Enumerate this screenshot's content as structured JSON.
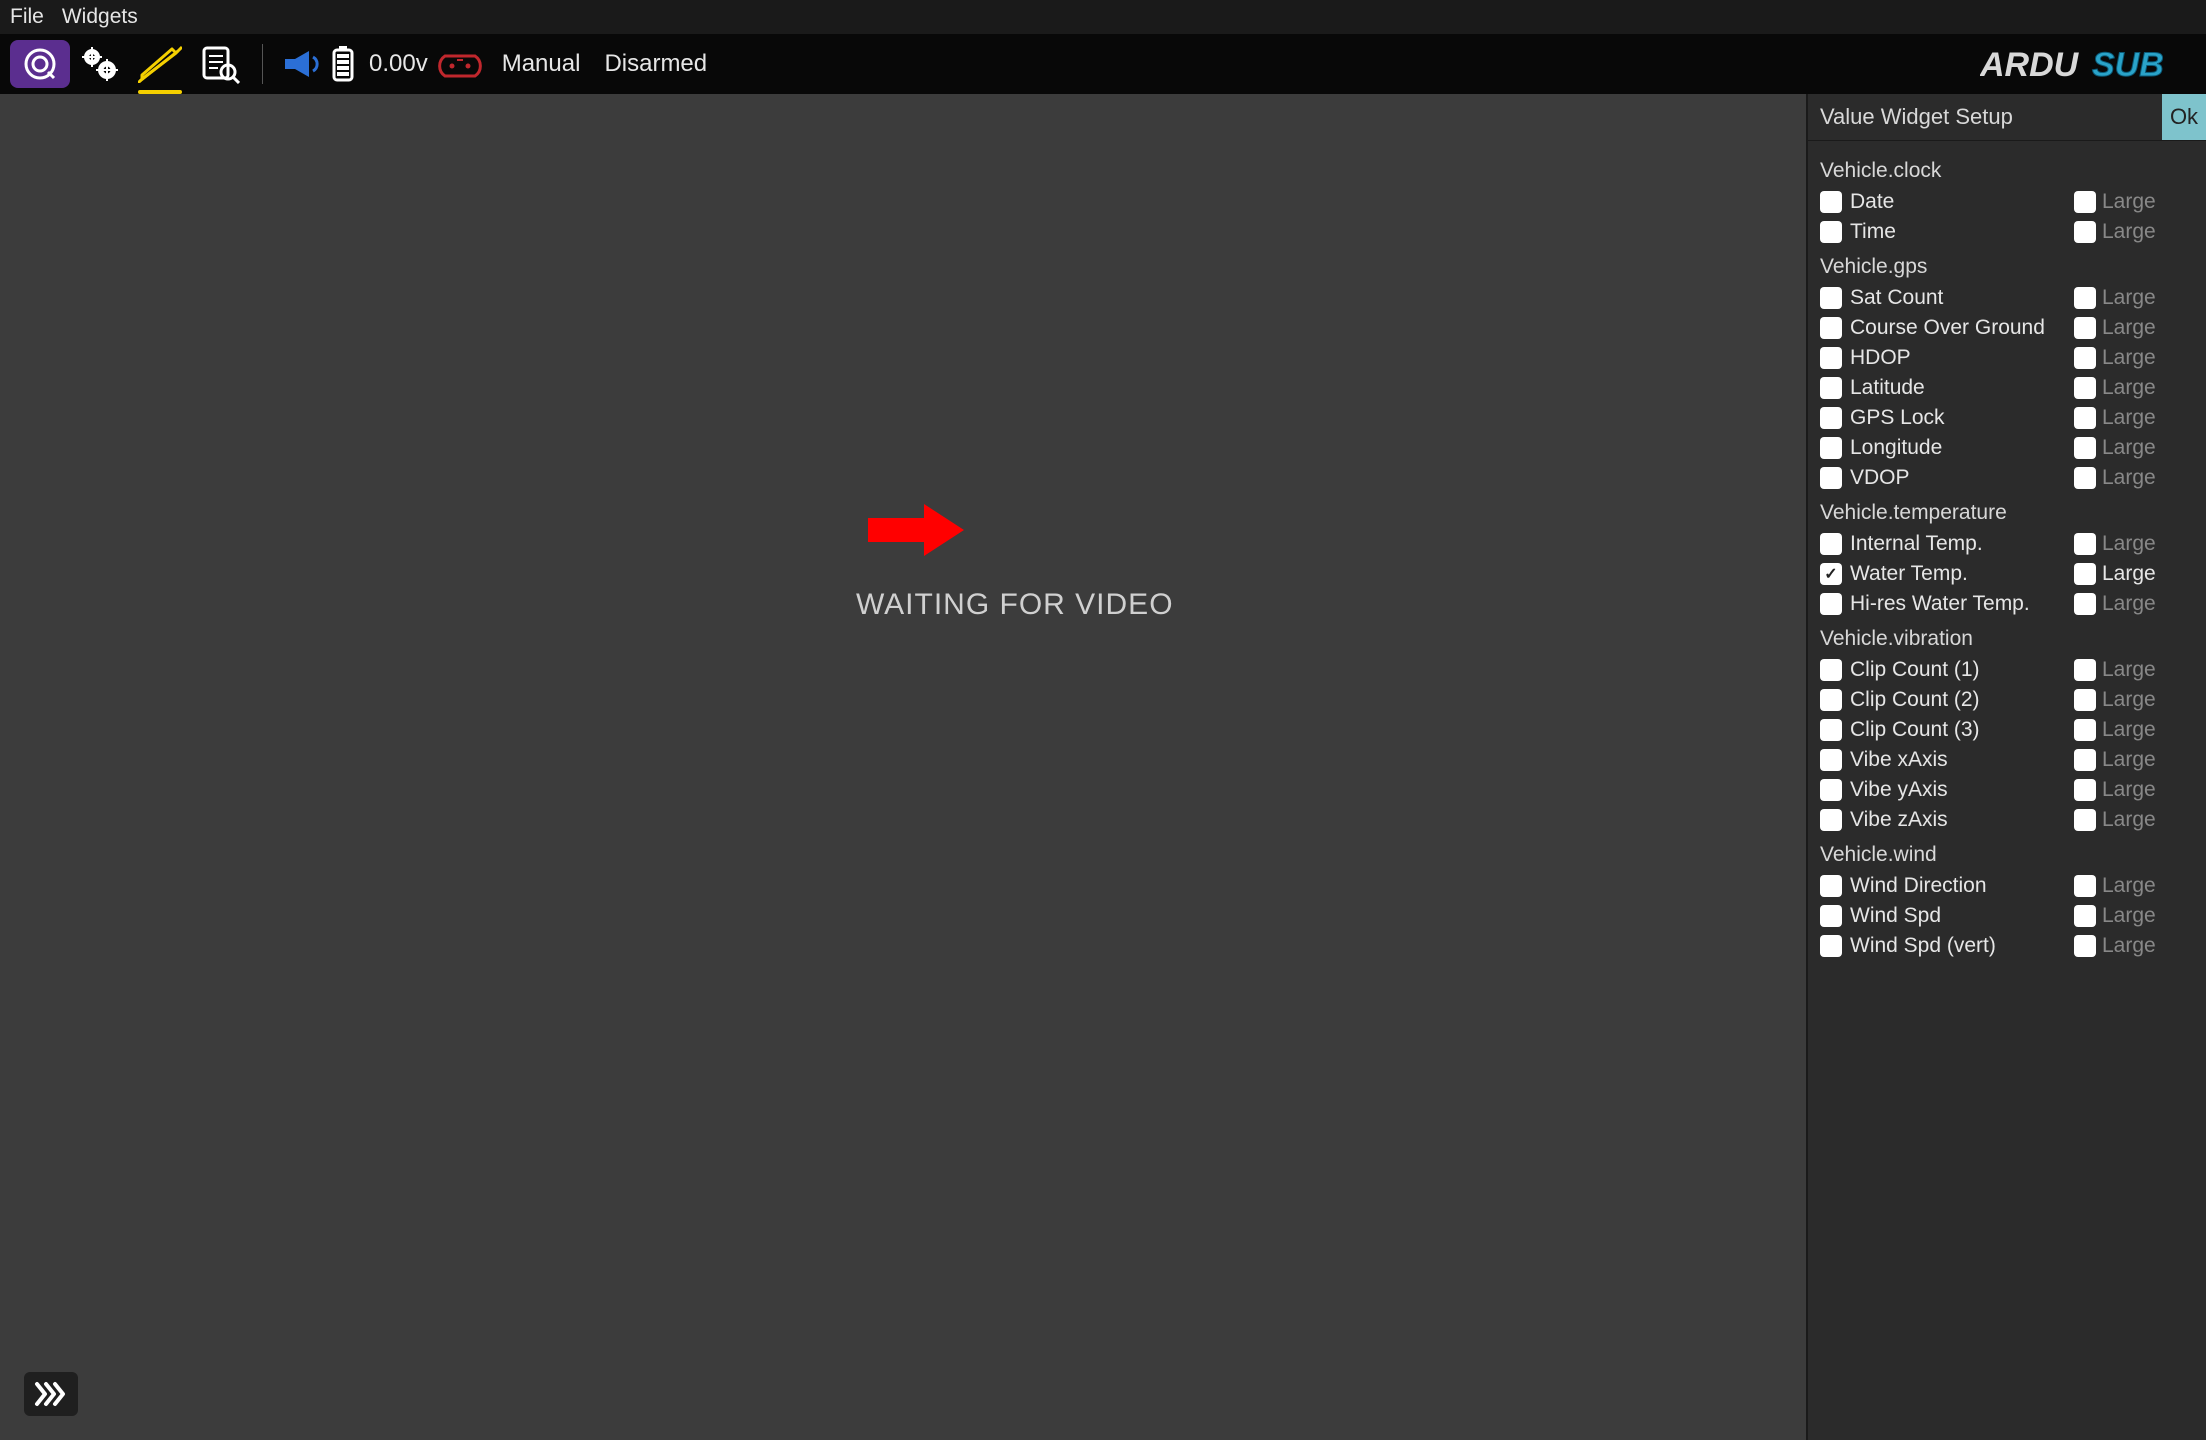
{
  "menubar": {
    "file": "File",
    "widgets": "Widgets"
  },
  "toolbar": {
    "voltage": "0.00v",
    "mode": "Manual",
    "armed": "Disarmed"
  },
  "brand": "ARDUSUB",
  "video_message": "WAITING FOR VIDEO",
  "panel": {
    "title": "Value Widget Setup",
    "ok": "Ok",
    "large_label": "Large",
    "groups": [
      {
        "name": "Vehicle.clock",
        "items": [
          {
            "label": "Date",
            "checked": false,
            "large": false
          },
          {
            "label": "Time",
            "checked": false,
            "large": false
          }
        ]
      },
      {
        "name": "Vehicle.gps",
        "items": [
          {
            "label": "Sat Count",
            "checked": false,
            "large": false
          },
          {
            "label": "Course Over Ground",
            "checked": false,
            "large": false
          },
          {
            "label": "HDOP",
            "checked": false,
            "large": false
          },
          {
            "label": "Latitude",
            "checked": false,
            "large": false
          },
          {
            "label": "GPS Lock",
            "checked": false,
            "large": false
          },
          {
            "label": "Longitude",
            "checked": false,
            "large": false
          },
          {
            "label": "VDOP",
            "checked": false,
            "large": false
          }
        ]
      },
      {
        "name": "Vehicle.temperature",
        "items": [
          {
            "label": "Internal Temp.",
            "checked": false,
            "large": false
          },
          {
            "label": "Water Temp.",
            "checked": true,
            "large": false
          },
          {
            "label": "Hi-res Water Temp.",
            "checked": false,
            "large": false
          }
        ]
      },
      {
        "name": "Vehicle.vibration",
        "items": [
          {
            "label": "Clip Count (1)",
            "checked": false,
            "large": false
          },
          {
            "label": "Clip Count (2)",
            "checked": false,
            "large": false
          },
          {
            "label": "Clip Count (3)",
            "checked": false,
            "large": false
          },
          {
            "label": "Vibe xAxis",
            "checked": false,
            "large": false
          },
          {
            "label": "Vibe yAxis",
            "checked": false,
            "large": false
          },
          {
            "label": "Vibe zAxis",
            "checked": false,
            "large": false
          }
        ]
      },
      {
        "name": "Vehicle.wind",
        "items": [
          {
            "label": "Wind Direction",
            "checked": false,
            "large": false
          },
          {
            "label": "Wind Spd",
            "checked": false,
            "large": false
          },
          {
            "label": "Wind Spd (vert)",
            "checked": false,
            "large": false
          }
        ]
      }
    ]
  }
}
